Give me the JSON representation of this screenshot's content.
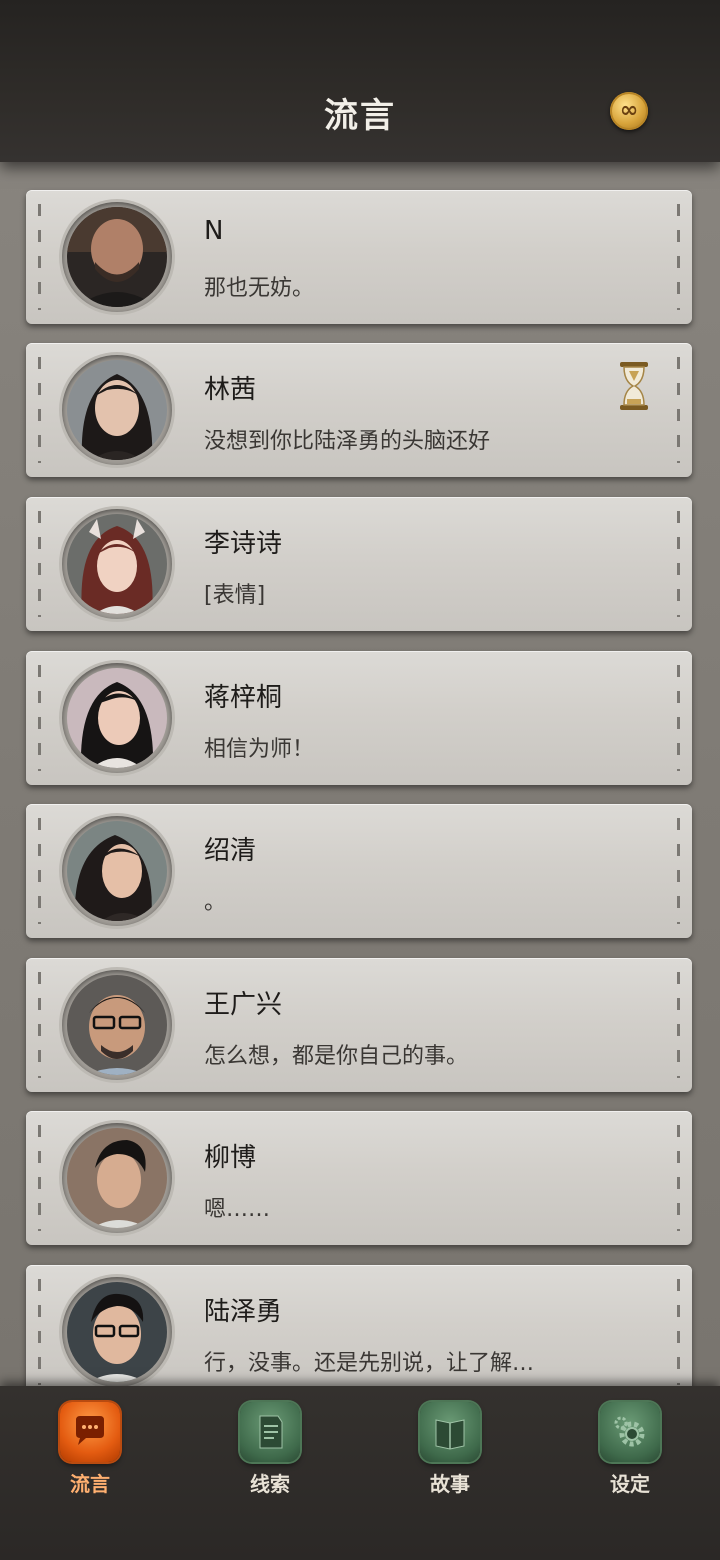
{
  "header": {
    "title": "流言",
    "coin_symbol": "∞"
  },
  "chats": [
    {
      "name": "N",
      "message": "那也无妨。",
      "avatar": "man-beard-dark",
      "has_timer": false
    },
    {
      "name": "林茜",
      "message": "没想到你比陆泽勇的头脑还好",
      "avatar": "woman-long-hair",
      "has_timer": true
    },
    {
      "name": "李诗诗",
      "message": "[表情]",
      "avatar": "woman-cat-ears",
      "has_timer": false
    },
    {
      "name": "蒋梓桐",
      "message": "相信为师！",
      "avatar": "woman-smile",
      "has_timer": false
    },
    {
      "name": "绍清",
      "message": "。",
      "avatar": "woman-dark-hair",
      "has_timer": false
    },
    {
      "name": "王广兴",
      "message": "怎么想，都是你自己的事。",
      "avatar": "man-glasses-beard",
      "has_timer": false
    },
    {
      "name": "柳博",
      "message": "嗯……",
      "avatar": "young-man",
      "has_timer": false
    },
    {
      "name": "陆泽勇",
      "message": "行，没事。还是先别说，让了解…",
      "avatar": "man-glasses",
      "has_timer": false
    }
  ],
  "tabs": [
    {
      "label": "流言",
      "active": true,
      "icon": "chat-bubble-icon"
    },
    {
      "label": "线索",
      "active": false,
      "icon": "document-icon"
    },
    {
      "label": "故事",
      "active": false,
      "icon": "book-icon"
    },
    {
      "label": "设定",
      "active": false,
      "icon": "gear-icon"
    }
  ]
}
